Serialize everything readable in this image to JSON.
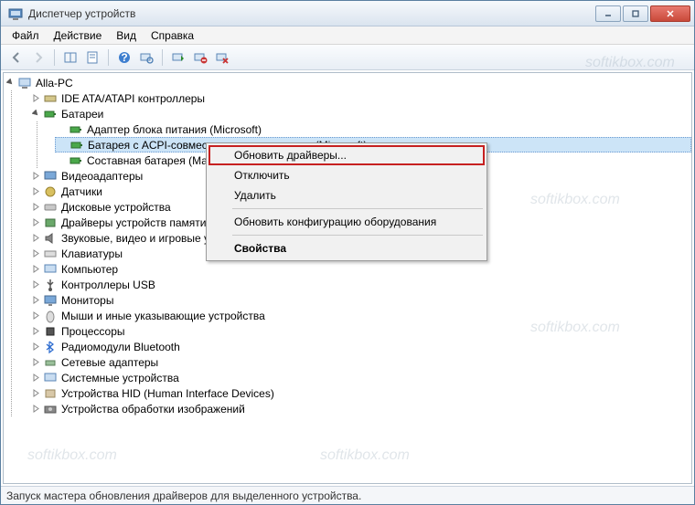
{
  "window": {
    "title": "Диспетчер устройств"
  },
  "menubar": [
    "Файл",
    "Действие",
    "Вид",
    "Справка"
  ],
  "statusbar": "Запуск мастера обновления драйверов для выделенного устройства.",
  "tree": {
    "root": "Alla-PC",
    "batteries": {
      "label": "Батареи",
      "children": [
        "Адаптер блока питания (Microsoft)",
        "Батарея с ACPI-совместимым управлением (Microsoft)",
        "Составная батарея (Майкрософт)"
      ]
    },
    "categories": [
      "IDE ATA/ATAPI контроллеры",
      "Видеоадаптеры",
      "Датчики",
      "Дисковые устройства",
      "Драйверы устройств памяти",
      "Звуковые, видео и игровые устройства",
      "Клавиатуры",
      "Компьютер",
      "Контроллеры USB",
      "Мониторы",
      "Мыши и иные указывающие устройства",
      "Процессоры",
      "Радиомодули Bluetooth",
      "Сетевые адаптеры",
      "Системные устройства",
      "Устройства HID (Human Interface Devices)",
      "Устройства обработки изображений"
    ]
  },
  "context_menu": {
    "update": "Обновить драйверы...",
    "disable": "Отключить",
    "delete": "Удалить",
    "scan": "Обновить конфигурацию оборудования",
    "props": "Свойства"
  },
  "watermark": "softikbox.com"
}
